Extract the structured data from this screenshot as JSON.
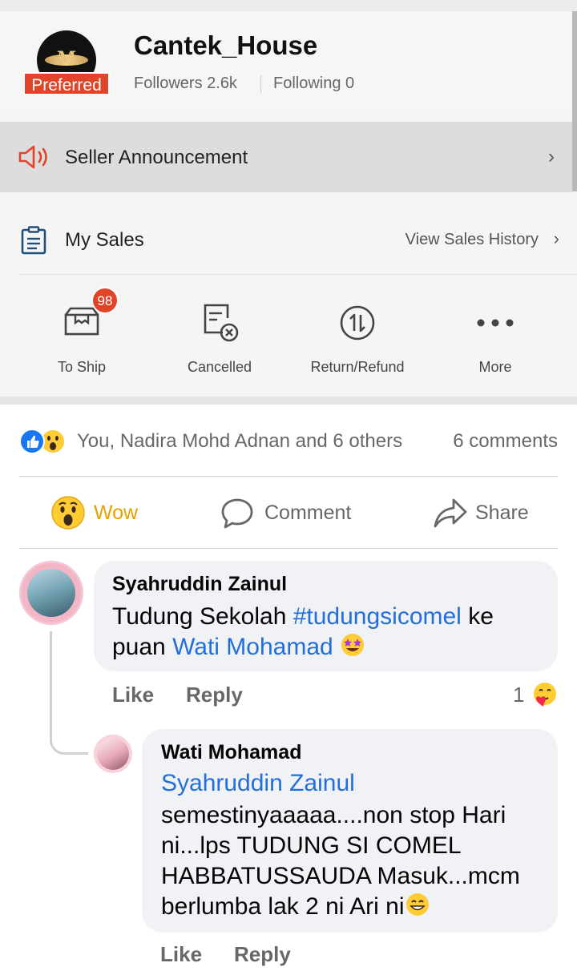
{
  "shop": {
    "name": "Cantek_House",
    "preferred_label": "Preferred",
    "followers": "Followers 2.6k",
    "following": "Following 0"
  },
  "announcement": {
    "label": "Seller Announcement"
  },
  "sales": {
    "title": "My Sales",
    "history_link": "View Sales History",
    "items": [
      {
        "label": "To Ship",
        "icon": "box-icon",
        "badge": "98"
      },
      {
        "label": "Cancelled",
        "icon": "cancelled-doc-icon"
      },
      {
        "label": "Return/Refund",
        "icon": "return-refund-icon"
      },
      {
        "label": "More",
        "icon": "more-dots-icon"
      }
    ]
  },
  "post": {
    "reactions_text": "You, Nadira Mohd Adnan and 6 others",
    "comments_count": "6 comments",
    "actions": {
      "wow": "Wow",
      "comment": "Comment",
      "share": "Share"
    }
  },
  "comments": [
    {
      "author": "Syahruddin Zainul",
      "text_a": "Tudung Sekolah ",
      "hashtag": "#tudungsicomel",
      "text_b": " ke puan ",
      "mention": "Wati Mohamad",
      "like_label": "Like",
      "reply_label": "Reply",
      "reaction_count": "1"
    },
    {
      "author": "Wati Mohamad",
      "mention": "Syahruddin Zainul",
      "text": "semestinyaaaaa....non stop Hari ni...lps TUDUNG SI COMEL HABBATUSSAUDA Masuk...mcm berlumba lak 2 ni Ari ni",
      "like_label": "Like",
      "reply_label": "Reply"
    }
  ],
  "colors": {
    "shopee_orange": "#e0452a",
    "facebook_blue": "#1877f2",
    "link_blue": "#216fdb",
    "wow_yellow": "#e8a000",
    "bubble_gray": "#f0f2f5"
  }
}
